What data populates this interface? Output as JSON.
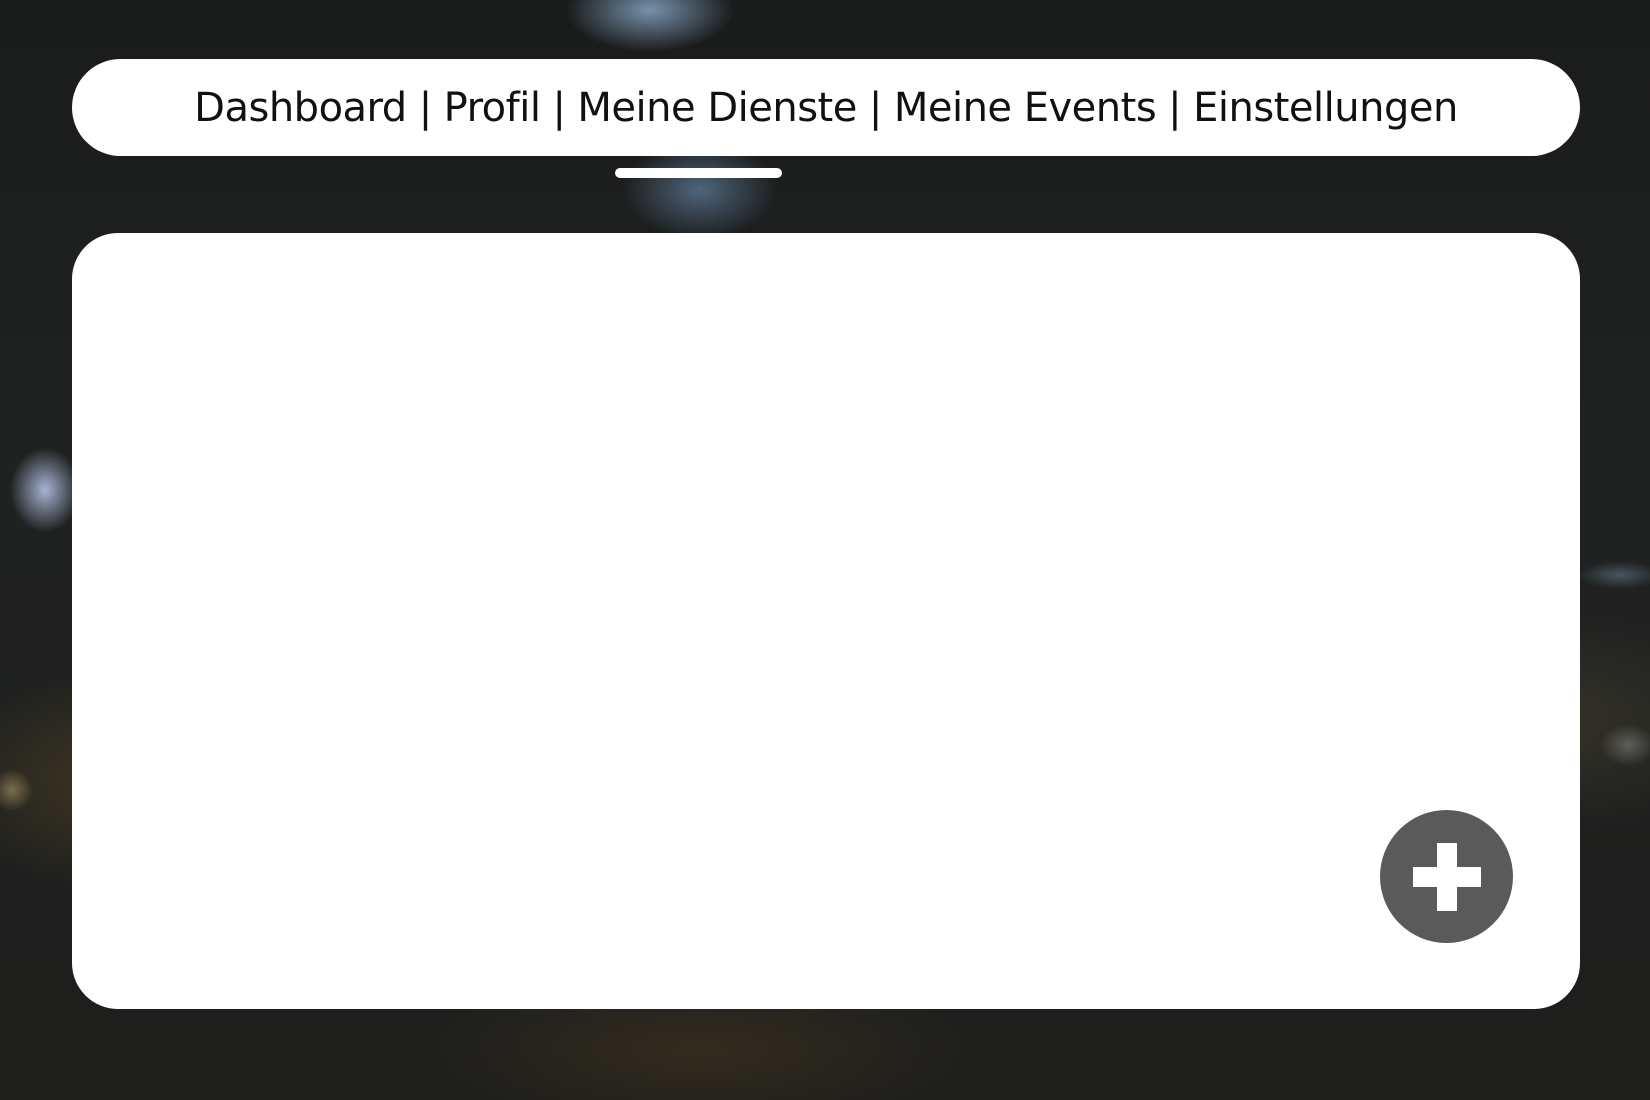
{
  "nav": {
    "items": [
      {
        "label": "Dashboard"
      },
      {
        "label": "Profil"
      },
      {
        "label": "Meine Dienste"
      },
      {
        "label": "Meine Events"
      },
      {
        "label": "Einstellungen"
      }
    ],
    "separator": "|",
    "active_index": 2
  },
  "fab": {
    "icon": "plus-icon",
    "color": "#5a5a5a"
  },
  "colors": {
    "panel": "#ffffff",
    "background": "#1b1c1c",
    "text": "#111111"
  }
}
